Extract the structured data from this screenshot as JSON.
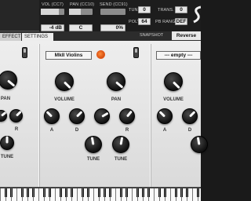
{
  "header": {
    "vol_label": "VOL (CC7)",
    "vol_value": "-4 dB",
    "vol_level": 0.78,
    "pan_label": "PAN (CC10)",
    "pan_value": "C",
    "pan_level": 0.5,
    "send_label": "SEND (CC91)",
    "send_value": "0%",
    "send_level": 0.0,
    "tune_label": "TUNE",
    "tune_value": "0",
    "trans_label": "TRANS.",
    "trans_value": "0",
    "poly_label": "POLY.",
    "poly_value": "64",
    "pbrange_label": "PB RANGE",
    "pbrange_value": "DEF"
  },
  "tabs": {
    "effects": "EFFECTS",
    "settings": "SETTINGS"
  },
  "snapshot": {
    "label": "SNAPSHOT",
    "value": "Reverse"
  },
  "slots": {
    "slot2_name": "MkII Violins",
    "slot3_name": "--- empty ---"
  },
  "knob_labels": {
    "pan": "PAN",
    "volume": "VOLUME",
    "a": "A",
    "d": "D",
    "r": "R",
    "tune": "TUNE"
  },
  "colors": {
    "led": "#e2581a",
    "panel": "#e6e6e6",
    "knob": "#1a1a1a"
  }
}
